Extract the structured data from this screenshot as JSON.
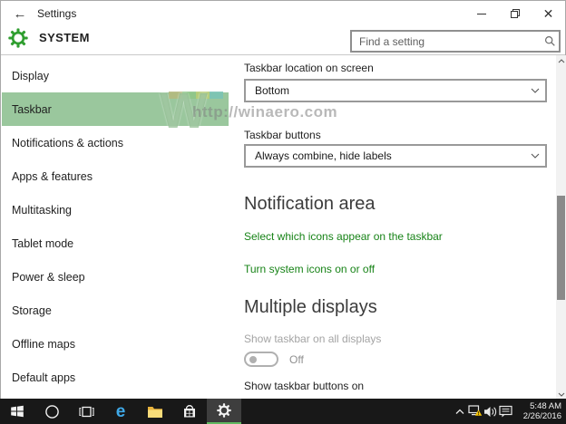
{
  "titlebar": {
    "title": "Settings"
  },
  "header": {
    "page_title": "SYSTEM",
    "search_placeholder": "Find a setting"
  },
  "sidebar": {
    "items": [
      {
        "label": "Display",
        "selected": false
      },
      {
        "label": "Taskbar",
        "selected": true
      },
      {
        "label": "Notifications & actions",
        "selected": false
      },
      {
        "label": "Apps & features",
        "selected": false
      },
      {
        "label": "Multitasking",
        "selected": false
      },
      {
        "label": "Tablet mode",
        "selected": false
      },
      {
        "label": "Power & sleep",
        "selected": false
      },
      {
        "label": "Storage",
        "selected": false
      },
      {
        "label": "Offline maps",
        "selected": false
      },
      {
        "label": "Default apps",
        "selected": false
      }
    ]
  },
  "content": {
    "taskbar_location_label": "Taskbar location on screen",
    "taskbar_location_value": "Bottom",
    "taskbar_buttons_label": "Taskbar buttons",
    "taskbar_buttons_value": "Always combine, hide labels",
    "notification_area_title": "Notification area",
    "link_select_icons": "Select which icons appear on the taskbar",
    "link_system_icons": "Turn system icons on or off",
    "multiple_displays_title": "Multiple displays",
    "show_taskbar_all_displays_label": "Show taskbar on all displays",
    "show_taskbar_all_displays_state": "Off",
    "show_taskbar_buttons_on_label": "Show taskbar buttons on"
  },
  "watermark": {
    "letter": "W",
    "url": "http://winaero.com"
  },
  "system_tray": {
    "time": "5:48 AM",
    "date": "2/26/2016"
  },
  "icons": {
    "header": "gear-icon",
    "search": "magnifier-icon",
    "taskbar_apps": [
      "start-icon",
      "cortana-icon",
      "task-view-icon",
      "edge-icon",
      "file-explorer-icon",
      "store-icon",
      "settings-gear-icon"
    ],
    "tray": [
      "chevron-up-icon",
      "network-warning-icon",
      "speaker-icon",
      "action-center-icon"
    ]
  },
  "colors": {
    "accent_green": "#2f9e2f",
    "selected_item_bg": "#9ac79d",
    "link_green": "#178317",
    "taskbar_bg": "#181818",
    "active_app_underline": "#5fb85f",
    "warning_yellow": "#f8c500"
  }
}
